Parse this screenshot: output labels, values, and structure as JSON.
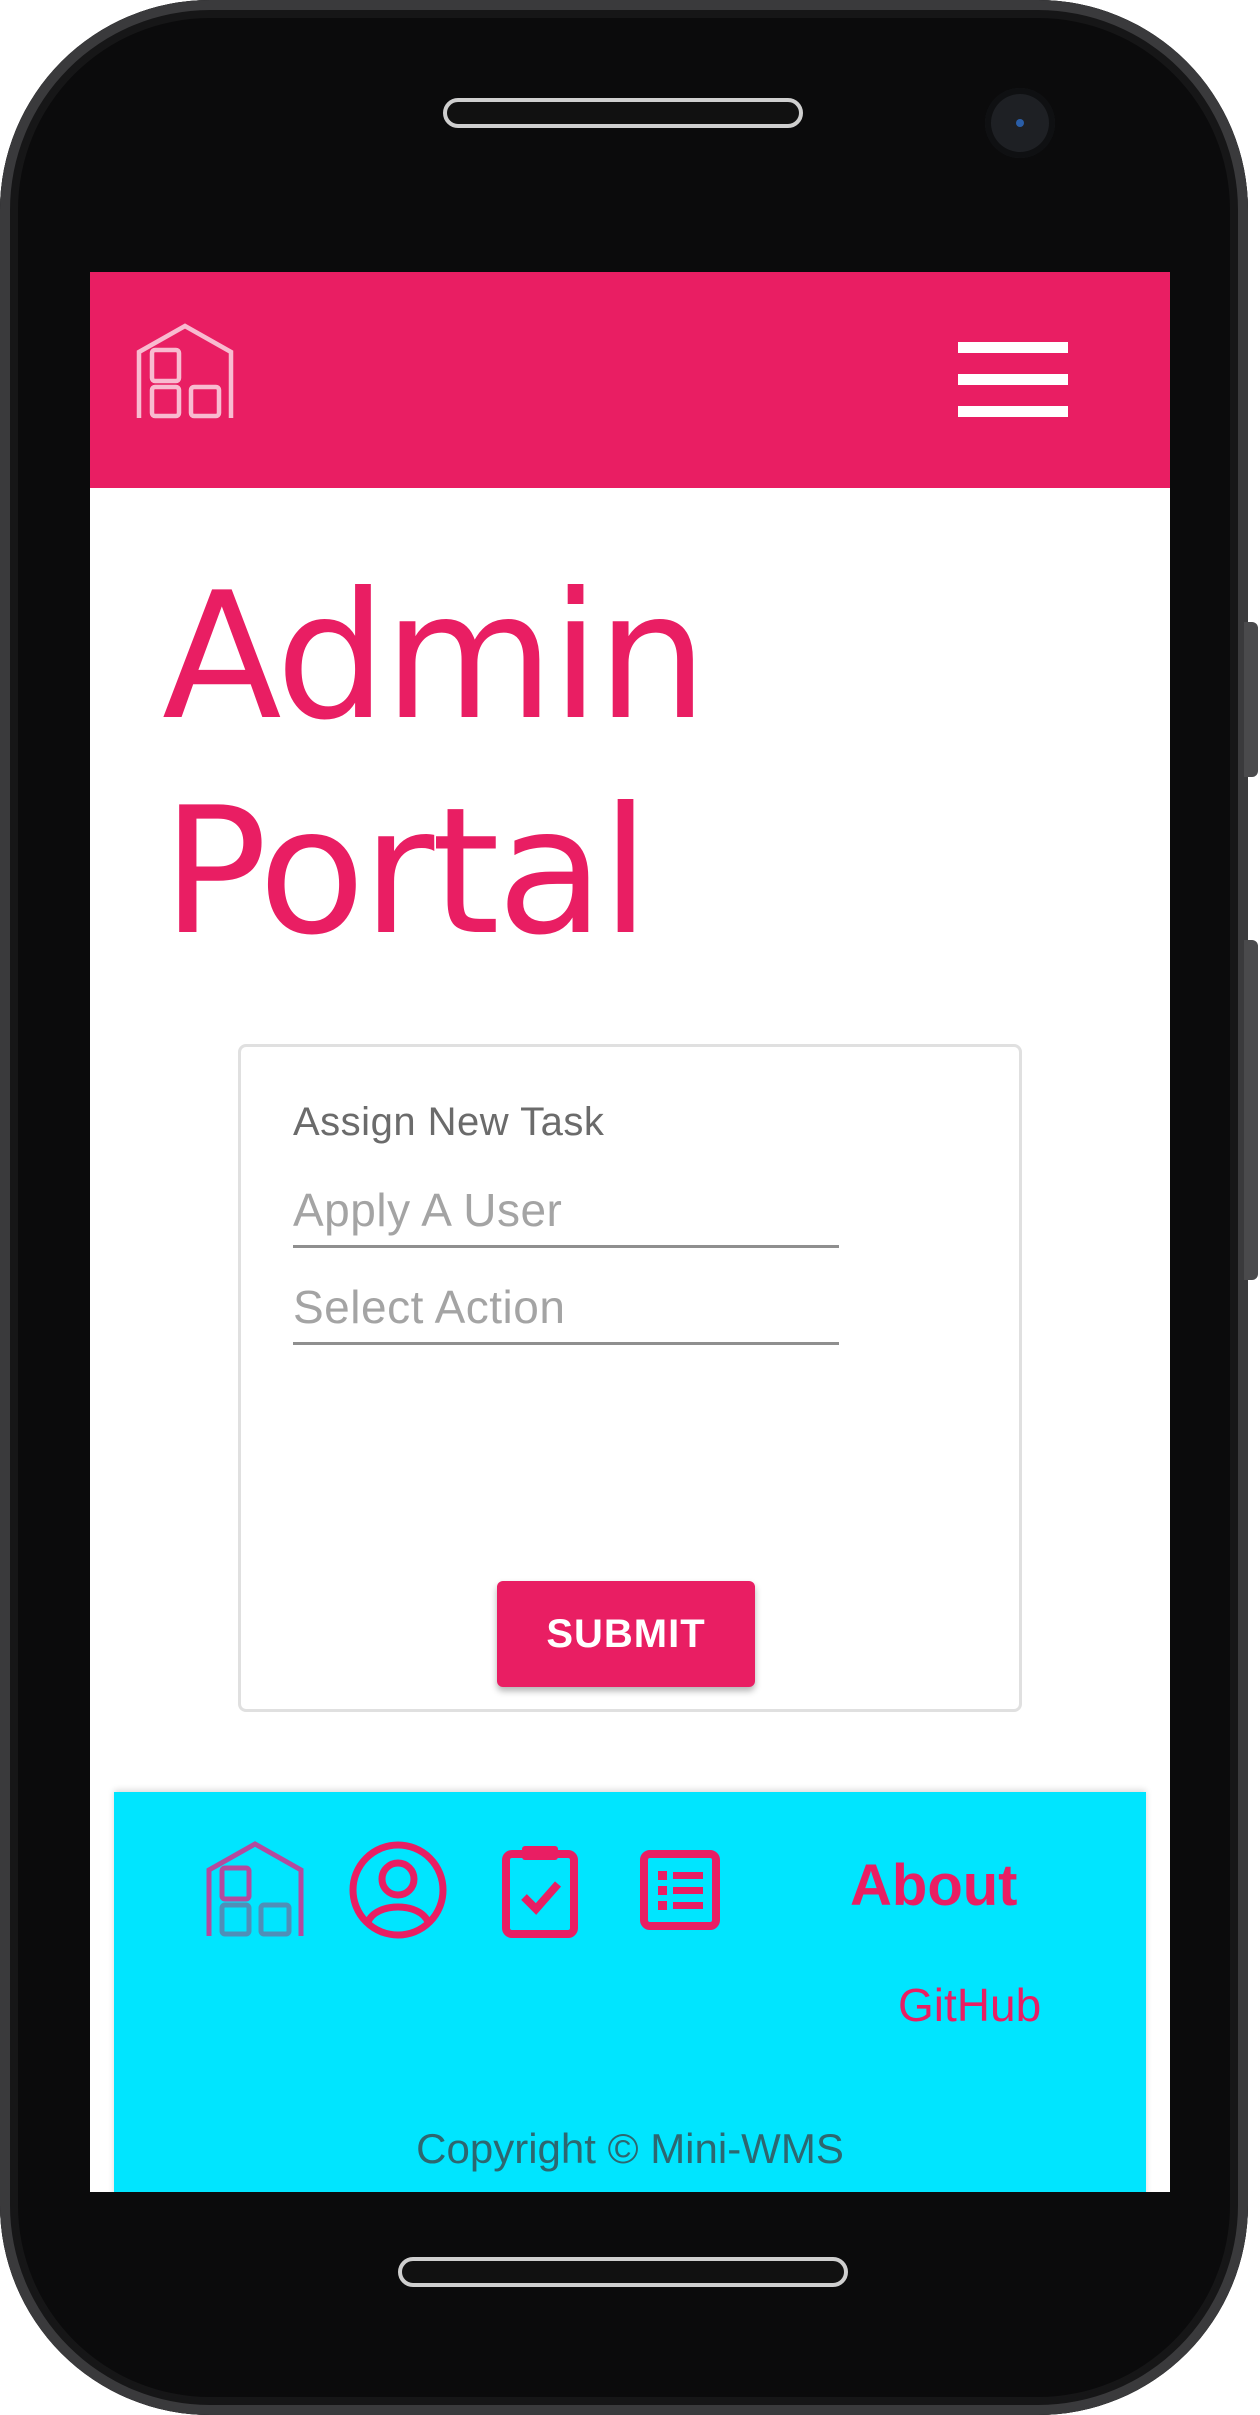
{
  "colors": {
    "accent": "#e91e63",
    "footer_background": "#00e5ff",
    "copyright_text": "#2d6770"
  },
  "header": {
    "logo_icon": "warehouse-icon",
    "menu_icon": "hamburger-menu-icon"
  },
  "page": {
    "title_line1": "Admin",
    "title_line2": "Portal"
  },
  "task_form": {
    "title": "Assign New Task",
    "user_placeholder": "Apply A User",
    "action_placeholder": "Select Action",
    "submit_label": "SUBMIT"
  },
  "footer": {
    "icons": [
      "warehouse-icon",
      "user-profile-icon",
      "clipboard-check-icon",
      "list-icon"
    ],
    "about_label": "About",
    "github_label": "GitHub",
    "copyright": "Copyright © Mini-WMS"
  }
}
